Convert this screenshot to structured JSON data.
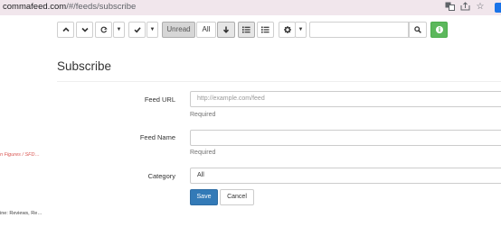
{
  "browser": {
    "url_host": "commafeed.com",
    "url_path": "/#/feeds/subscribe",
    "icons": [
      "translate-icon",
      "share-icon",
      "star-icon",
      "extension-icon"
    ]
  },
  "toolbar": {
    "icons": [
      "chevron-up-icon",
      "chevron-down-icon",
      "refresh-icon",
      "caret-down-icon",
      "check-icon",
      "caret-down-icon",
      "arrow-down-icon",
      "list-icon",
      "list-compact-icon",
      "gear-icon",
      "caret-down-icon",
      "search-icon",
      "info-icon"
    ],
    "unread_label": "Unread",
    "all_label": "All",
    "search_value": ""
  },
  "sidebar": {
    "items": [
      "n Figures / SFD…",
      "ine: Reviews, Re…"
    ]
  },
  "form": {
    "title": "Subscribe",
    "feed_url_label": "Feed URL",
    "feed_url_placeholder": "http://example.com/feed",
    "feed_url_help": "Required",
    "feed_name_label": "Feed Name",
    "feed_name_value": "",
    "feed_name_help": "Required",
    "category_label": "Category",
    "category_value": "All",
    "save_label": "Save",
    "cancel_label": "Cancel"
  },
  "colors": {
    "primary": "#337ab7",
    "success": "#5cb85c",
    "danger_text": "#d9534f",
    "browser_bar": "#f1e6ec"
  }
}
